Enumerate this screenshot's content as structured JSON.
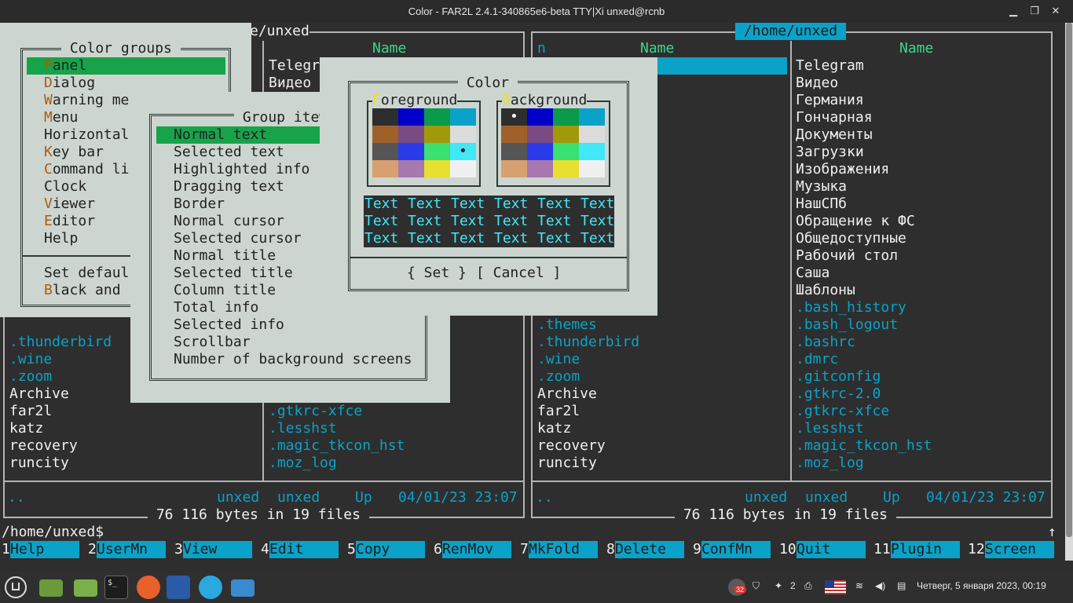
{
  "window": {
    "title": "Color - FAR2L 2.4.1-340865e6-beta TTY|Xi unxed@rcnb"
  },
  "left_panel": {
    "path_fragment": "e/unxed",
    "col_name": "Name",
    "col2_items": [
      "Telegr",
      "Видео"
    ],
    "col1_items": [
      ".thunderbird",
      ".wine",
      ".zoom",
      "Archive",
      "far2l",
      "katz",
      "recovery",
      "runcity"
    ],
    "col1_colors": [
      "cy",
      "cy",
      "cy",
      "wt",
      "wt",
      "wt",
      "wt",
      "wt"
    ],
    "col2_bottom": [
      ".gtkrc-xfce",
      ".lesshst",
      ".magic_tkcon_hst",
      ".moz_log"
    ],
    "status": {
      "name": "..",
      "owner": "unxed",
      "group": "unxed",
      "up": "Up",
      "date": "04/01/23 23:07"
    },
    "footer": " 76 116 bytes in 19 files "
  },
  "right_panel": {
    "path": "/home/unxed",
    "col1_header": "n",
    "col_name_1": "Name",
    "col_name_2": "Name",
    "col1_items": [
      ".themes",
      ".thunderbird",
      ".wine",
      ".zoom",
      "Archive",
      "far2l",
      "katz",
      "recovery",
      "runcity"
    ],
    "col1_colors": [
      "cy",
      "cy",
      "cy",
      "cy",
      "wt",
      "wt",
      "wt",
      "wt",
      "wt"
    ],
    "col2_items": [
      "Telegram",
      "Видео",
      "Германия",
      "Гончарная",
      "Документы",
      "Загрузки",
      "Изображения",
      "Музыка",
      "НашСПб",
      "Обращение к ФС",
      "Общедоступные",
      "Рабочий стол",
      "Саша",
      "Шаблоны",
      ".bash_history",
      ".bash_logout",
      ".bashrc",
      ".dmrc",
      ".gitconfig",
      ".gtkrc-2.0",
      ".gtkrc-xfce",
      ".lesshst",
      ".magic_tkcon_hst",
      ".moz_log"
    ],
    "col2_colors": [
      "wt",
      "wt",
      "wt",
      "wt",
      "wt",
      "wt",
      "wt",
      "wt",
      "wt",
      "wt",
      "wt",
      "wt",
      "wt",
      "wt",
      "cy",
      "cy",
      "cy",
      "cy",
      "cy",
      "cy",
      "cy",
      "cy",
      "cy",
      "cy"
    ],
    "status": {
      "name": "..",
      "owner": "unxed",
      "group": "unxed",
      "up": "Up",
      "date": "04/01/23 23:07"
    },
    "footer": " 76 116 bytes in 19 files "
  },
  "command_line": {
    "prompt": "/home/unxed$",
    "arrow": "↑"
  },
  "keybar": [
    {
      "num": "1",
      "label": "Help"
    },
    {
      "num": "2",
      "label": "UserMn"
    },
    {
      "num": "3",
      "label": "View"
    },
    {
      "num": "4",
      "label": "Edit"
    },
    {
      "num": "5",
      "label": "Copy"
    },
    {
      "num": "6",
      "label": "RenMov"
    },
    {
      "num": "7",
      "label": "MkFold"
    },
    {
      "num": "8",
      "label": "Delete"
    },
    {
      "num": "9",
      "label": "ConfMn"
    },
    {
      "num": "10",
      "label": "Quit"
    },
    {
      "num": "11",
      "label": "Plugin"
    },
    {
      "num": "12",
      "label": "Screen"
    }
  ],
  "color_groups": {
    "title": " Color groups ",
    "items": [
      {
        "hot": "P",
        "rest": "anel",
        "selected": true
      },
      {
        "hot": "D",
        "rest": "ialog"
      },
      {
        "hot": "W",
        "rest": "arning me"
      },
      {
        "hot": "M",
        "rest": "enu"
      },
      {
        "hot": "",
        "rest": "Horizontal"
      },
      {
        "hot": "K",
        "rest": "ey bar"
      },
      {
        "hot": "C",
        "rest": "ommand li"
      },
      {
        "hot": "",
        "rest": "Clock"
      },
      {
        "hot": "V",
        "rest": "iewer"
      },
      {
        "hot": "E",
        "rest": "ditor"
      },
      {
        "hot": "",
        "rest": "Help"
      }
    ],
    "extra": [
      {
        "hot": "",
        "rest": "Set defaul"
      },
      {
        "hot": "B",
        "rest": "lack and"
      }
    ]
  },
  "group_items": {
    "title": " Group ite",
    "items": [
      "Normal text",
      "Selected text",
      "Highlighted info",
      "Dragging text",
      "Border",
      "Normal cursor",
      "Selected cursor",
      "Normal title",
      "Selected title",
      "Column title",
      "Total info",
      "Selected info",
      "Scrollbar",
      "Number of background screens"
    ]
  },
  "color_dialog": {
    "title": " Color ",
    "fg_hot": "F",
    "fg_rest": "oreground",
    "bg_hot": "B",
    "bg_rest": "ackground",
    "palette": [
      "#2e2e2e",
      "#0000c8",
      "#0a9a4a",
      "#0aa2c8",
      "#a0602a",
      "#7a4a82",
      "#a09a0a",
      "#dcdcdc",
      "#555555",
      "#2a3ae8",
      "#3ae070",
      "#40e8f8",
      "#d8a070",
      "#a878b0",
      "#e8e030",
      "#f0f0f0"
    ],
    "sample_word": "Text",
    "sample_bg": "#2e2e2e",
    "sample_fg": "#40e8f8",
    "fg_marker": "•",
    "bg_marker": "•",
    "set_label": "{ Set }",
    "cancel_label": "[ Cancel ]"
  },
  "colors": {
    "accent_cyan": "#0aa2c8",
    "selection_green": "#17a34a",
    "dialog_bg": "#ccd5d0"
  },
  "taskbar": {
    "notify_count": "32",
    "workspace": "2",
    "clock": "Четверг, 5 января 2023, 00:19",
    "icons": [
      "mint-menu-icon",
      "folder-icon",
      "folder-icon",
      "terminal-icon",
      "firefox-icon",
      "file-manager-icon",
      "telegram-icon",
      "screenshot-icon"
    ]
  }
}
